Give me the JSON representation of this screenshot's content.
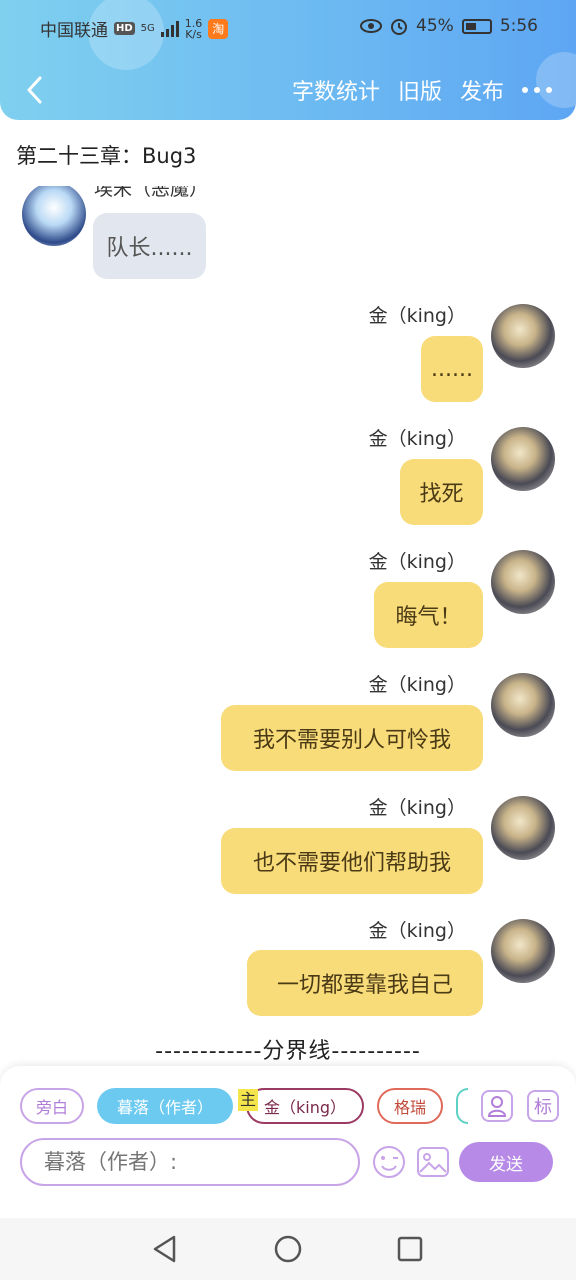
{
  "status_bar": {
    "carrier": "中国联通",
    "hd_badge": "HD",
    "network": "5G",
    "speed_value": "1.6",
    "speed_unit": "K/s",
    "app_badge": "淘",
    "battery": "45%",
    "time": "5:56"
  },
  "nav": {
    "word_count": "字数统计",
    "old_version": "旧版",
    "publish": "发布"
  },
  "chapter_title": "第二十三章：Bug3",
  "messages": [
    {
      "side": "left",
      "speaker": "埃米（恶魔）",
      "text": "队长......"
    },
    {
      "side": "right",
      "speaker": "金（king）",
      "text": "......"
    },
    {
      "side": "right",
      "speaker": "金（king）",
      "text": "找死"
    },
    {
      "side": "right",
      "speaker": "金（king）",
      "text": "晦气！"
    },
    {
      "side": "right",
      "speaker": "金（king）",
      "text": "我不需要别人可怜我"
    },
    {
      "side": "right",
      "speaker": "金（king）",
      "text": "也不需要他们帮助我"
    },
    {
      "side": "right",
      "speaker": "金（king）",
      "text": "一切都要靠我自己"
    }
  ],
  "divider": "------------分界线----------",
  "roles": {
    "narration": "旁白",
    "author": "暮落（作者）",
    "main_tag": "主",
    "king": "金（king）",
    "gerui": "格瑞",
    "tag_button": "标"
  },
  "composer": {
    "placeholder": "暮落（作者）:",
    "send": "发送"
  },
  "colors": {
    "header": "#6bb8f2",
    "bubble_right": "#f8dc7a",
    "bubble_left": "#e2e6ee",
    "accent": "#b68ae6"
  }
}
